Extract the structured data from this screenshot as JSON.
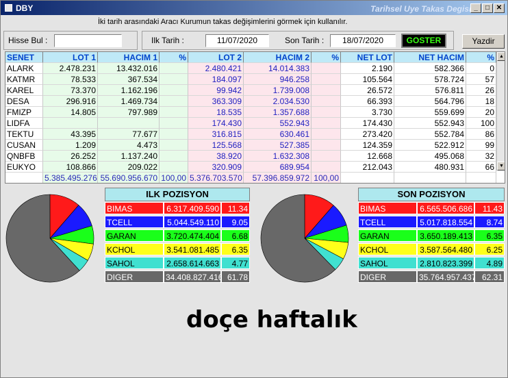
{
  "window": {
    "title": "DBY",
    "caption": "Tarihsel Uye Takas Degisim",
    "btn_min": "_",
    "btn_max": "□",
    "btn_close": "✕"
  },
  "instruction": "İki tarih arasındaki  Aracı Kurumun takas değişimlerini görmek için kullanılır.",
  "form": {
    "search_label": "Hisse Bul :",
    "search_value": "",
    "start_label": "Ilk Tarih :",
    "start_date": "11/07/2020",
    "end_label": "Son Tarih :",
    "end_date": "18/07/2020",
    "show_button": "GOSTER",
    "print_button": "Yazdir"
  },
  "table": {
    "headers": [
      "SENET",
      "LOT 1",
      "HACIM 1",
      "%",
      "LOT 2",
      "HACIM 2",
      "%",
      "NET LOT",
      "NET HACIM",
      "%"
    ],
    "rows": [
      [
        "ALARK",
        "2.478.231",
        "13.432.016",
        "",
        "2.480.421",
        "14.014.383",
        "",
        "2.190",
        "582.366",
        "0"
      ],
      [
        "KATMR",
        "78.533",
        "367.534",
        "",
        "184.097",
        "946.258",
        "",
        "105.564",
        "578.724",
        "57"
      ],
      [
        "KAREL",
        "73.370",
        "1.162.196",
        "",
        "99.942",
        "1.739.008",
        "",
        "26.572",
        "576.811",
        "26"
      ],
      [
        "DESA",
        "296.916",
        "1.469.734",
        "",
        "363.309",
        "2.034.530",
        "",
        "66.393",
        "564.796",
        "18"
      ],
      [
        "FMIZP",
        "14.805",
        "797.989",
        "",
        "18.535",
        "1.357.688",
        "",
        "3.730",
        "559.699",
        "20"
      ],
      [
        "LIDFA",
        "",
        "",
        "",
        "174.430",
        "552.943",
        "",
        "174.430",
        "552.943",
        "100"
      ],
      [
        "TEKTU",
        "43.395",
        "77.677",
        "",
        "316.815",
        "630.461",
        "",
        "273.420",
        "552.784",
        "86"
      ],
      [
        "CUSAN",
        "1.209",
        "4.473",
        "",
        "125.568",
        "527.385",
        "",
        "124.359",
        "522.912",
        "99"
      ],
      [
        "QNBFB",
        "26.252",
        "1.137.240",
        "",
        "38.920",
        "1.632.308",
        "",
        "12.668",
        "495.068",
        "32"
      ],
      [
        "EUKYO",
        "108.866",
        "209.022",
        "",
        "320.909",
        "689.954",
        "",
        "212.043",
        "480.931",
        "66"
      ]
    ],
    "totals": [
      "",
      "5.385.495.276",
      "55.690.956.670",
      "100,00",
      "5.376.703.570",
      "57.396.859.972",
      "100,00",
      "",
      "",
      ""
    ]
  },
  "first_position": {
    "title": "ILK POZISYON",
    "rows": [
      {
        "name": "BIMAS",
        "value": "6.317.409.590",
        "pct": "11.34",
        "color": "#ff1a1a",
        "text": "#ffffff"
      },
      {
        "name": "TCELL",
        "value": "5.044.549.110",
        "pct": "9.05",
        "color": "#1a1aff",
        "text": "#ffffff"
      },
      {
        "name": "GARAN",
        "value": "3.720.474.404",
        "pct": "6.68",
        "color": "#1aff1a",
        "text": "#000000"
      },
      {
        "name": "KCHOL",
        "value": "3.541.081.485",
        "pct": "6.35",
        "color": "#ffff1a",
        "text": "#000000"
      },
      {
        "name": "SAHOL",
        "value": "2.658.614.663",
        "pct": "4.77",
        "color": "#40e0d0",
        "text": "#000000"
      },
      {
        "name": "DIGER",
        "value": "34.408.827.416",
        "pct": "61.78",
        "color": "#686868",
        "text": "#ffffff"
      }
    ]
  },
  "last_position": {
    "title": "SON POZISYON",
    "rows": [
      {
        "name": "BIMAS",
        "value": "6.565.506.686",
        "pct": "11.43",
        "color": "#ff1a1a",
        "text": "#ffffff"
      },
      {
        "name": "TCELL",
        "value": "5.017.818.554",
        "pct": "8.74",
        "color": "#1a1aff",
        "text": "#ffffff"
      },
      {
        "name": "GARAN",
        "value": "3.650.189.413",
        "pct": "6.35",
        "color": "#1aff1a",
        "text": "#000000"
      },
      {
        "name": "KCHOL",
        "value": "3.587.564.480",
        "pct": "6.25",
        "color": "#ffff1a",
        "text": "#000000"
      },
      {
        "name": "SAHOL",
        "value": "2.810.823.399",
        "pct": "4.89",
        "color": "#40e0d0",
        "text": "#000000"
      },
      {
        "name": "DIGER",
        "value": "35.764.957.437",
        "pct": "62.31",
        "color": "#686868",
        "text": "#ffffff"
      }
    ]
  },
  "overlay_text": "doçe haftalık"
}
